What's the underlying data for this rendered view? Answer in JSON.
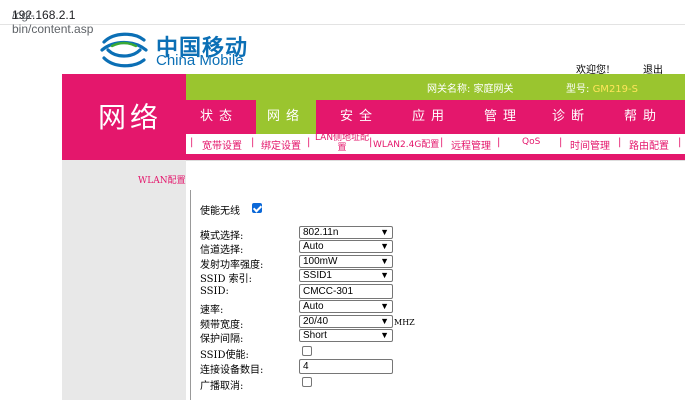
{
  "browser": {
    "url_host": "192.168.2.1",
    "url_path": "/cgi-bin/content.asp"
  },
  "brand": {
    "name_cn": "中国移动",
    "name_en": "China Mobile",
    "colors": {
      "brand_blue": "#0b6fb5",
      "magenta": "#e4176c",
      "green": "#9ac52f"
    }
  },
  "header": {
    "welcome": "欢迎您!",
    "logout": "退出",
    "gateway_name": "网关名称: 家庭网关",
    "model_label": "型号: ",
    "model_value": "GM219-S",
    "section_title": "网络"
  },
  "tabs": [
    {
      "label": "状态",
      "active": false
    },
    {
      "label": "网络",
      "active": true
    },
    {
      "label": "安全",
      "active": false
    },
    {
      "label": "应用",
      "active": false
    },
    {
      "label": "管理",
      "active": false
    },
    {
      "label": "诊断",
      "active": false
    },
    {
      "label": "帮助",
      "active": false
    }
  ],
  "subtabs": [
    "宽带设置",
    "绑定设置",
    "LAN侧地址配置",
    "WLAN2.4G配置",
    "远程管理",
    "QoS",
    "时间管理",
    "路由配置"
  ],
  "sidebar": {
    "link": "WLAN配置"
  },
  "form": {
    "enable_wireless": {
      "label": "使能无线",
      "checked": true
    },
    "mode": {
      "label": "模式选择:",
      "value": "802.11n"
    },
    "channel": {
      "label": "信道选择:",
      "value": "Auto"
    },
    "tx_power": {
      "label": "发射功率强度:",
      "value": "100mW"
    },
    "ssid_index": {
      "label": "SSID 索引:",
      "value": "SSID1"
    },
    "ssid": {
      "label": "SSID:",
      "value": "CMCC-301"
    },
    "rate": {
      "label": "速率:",
      "value": "Auto"
    },
    "bandwidth": {
      "label": "频带宽度:",
      "value": "20/40",
      "unit": "MHZ"
    },
    "guard_interval": {
      "label": "保护间隔:",
      "value": "Short"
    },
    "ssid_enable": {
      "label": "SSID使能:",
      "checked": false
    },
    "max_clients": {
      "label": "连接设备数目:",
      "value": "4"
    },
    "broadcast_cancel": {
      "label": "广播取消:",
      "checked": false
    }
  }
}
